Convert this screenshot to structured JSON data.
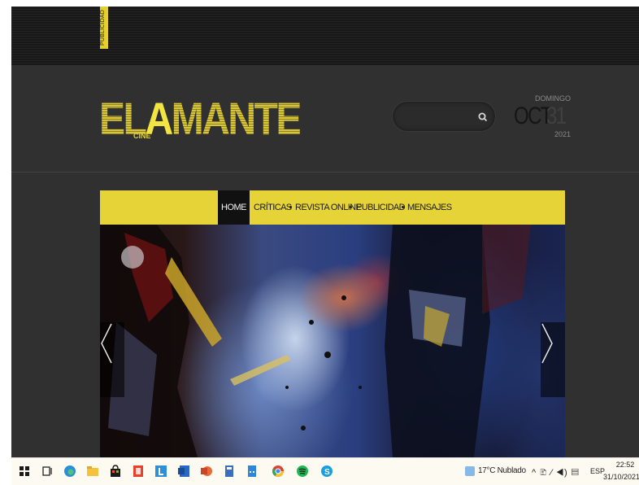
{
  "ad": {
    "label": "PUBLICIDAD"
  },
  "site": {
    "logo_word": "ELAMANTE",
    "logo_prefix": "EL",
    "logo_a": "A",
    "logo_suffix": "MANTE",
    "logo_sub": "CINE",
    "accent": "#e6d338"
  },
  "search": {
    "value": "",
    "placeholder": ""
  },
  "date": {
    "day": "DOMINGO",
    "month": "OCT",
    "num": "31",
    "year": "2021"
  },
  "nav": {
    "items": [
      {
        "label": "HOME",
        "active": true
      },
      {
        "label": "CRÍTICAS"
      },
      {
        "label": "REVISTA ONLINE"
      },
      {
        "label": "PUBLICIDAD"
      },
      {
        "label": "MENSAJES"
      }
    ]
  },
  "slider": {
    "prev_icon": "chevron-left-icon",
    "next_icon": "chevron-right-icon"
  },
  "taskbar": {
    "icons": [
      "windows-start-icon",
      "task-view-icon",
      "edge-icon",
      "file-explorer-icon",
      "store-icon",
      "office-icon",
      "lexicon-icon",
      "word-icon",
      "powerpoint-icon",
      "calculator-icon",
      "calculator2-icon",
      "chrome-icon",
      "spotify-icon",
      "skype-icon"
    ],
    "weather": "17°C  Nublado",
    "tray": "^ 🗈 ⁄ ◀) ▤",
    "lang": "ESP",
    "time": "22:52",
    "date": "31/10/2021"
  }
}
